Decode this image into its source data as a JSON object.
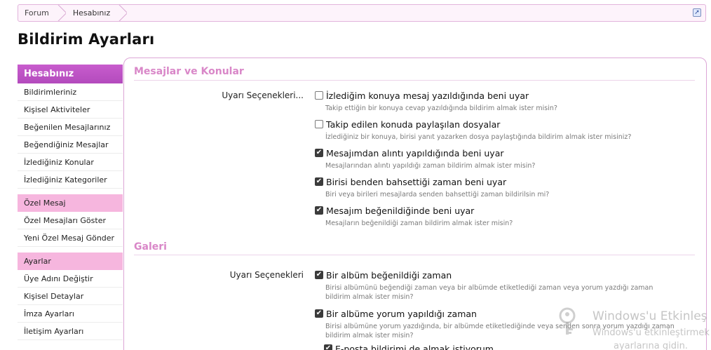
{
  "breadcrumb": {
    "items": [
      "Forum",
      "Hesabınız"
    ],
    "jump_icon": "jump-arrow-icon"
  },
  "page_title": "Bildirim Ayarları",
  "sidebar": {
    "header": "Hesabınız",
    "account_items": [
      "Bildirimleriniz",
      "Kişisel Aktiviteler",
      "Beğenilen Mesajlarınız",
      "Beğendiğiniz Mesajlar",
      "İzlediğiniz Konular",
      "İzlediğiniz Kategoriler"
    ],
    "pm_header": "Özel Mesaj",
    "pm_items": [
      "Özel Mesajları Göster",
      "Yeni Özel Mesaj Gönder"
    ],
    "settings_header": "Ayarlar",
    "settings_items": [
      "Üye Adını Değiştir",
      "Kişisel Detaylar",
      "İmza Ayarları",
      "İletişim Ayarları"
    ]
  },
  "sections": {
    "messages": {
      "title": "Mesajlar ve Konular",
      "row_label": "Uyarı Seçenekleri...",
      "options": [
        {
          "label": "İzlediğim konuya mesaj yazıldığında beni uyar",
          "hint": "Takip ettiğin bir konuya cevap yazıldığında bildirim almak ister misin?",
          "checked": false
        },
        {
          "label": "Takip edilen konuda paylaşılan dosyalar",
          "hint": "İzlediğiniz bir konuya, birisi yanıt yazarken dosya paylaştığında bildirim almak ister misiniz?",
          "checked": false
        },
        {
          "label": "Mesajımdan alıntı yapıldığında beni uyar",
          "hint": "Mesajlarından alıntı yapıldığı zaman bildirim almak ister misin?",
          "checked": true
        },
        {
          "label": "Birisi benden bahsettiği zaman beni uyar",
          "hint": "Biri veya birileri mesajlarda senden bahsettiği zaman bildirilsin mi?",
          "checked": true
        },
        {
          "label": "Mesajım beğenildiğinde beni uyar",
          "hint": "Mesajların beğenildiği zaman bildirim almak ister misin?",
          "checked": true
        }
      ]
    },
    "gallery": {
      "title": "Galeri",
      "row_label": "Uyarı Seçenekleri",
      "options": [
        {
          "label": "Bir albüm beğenildiği zaman",
          "hint": "Birisi albümünü beğendiği zaman veya bir albümde etiketlediği zaman veya yorum yazdığı zaman bildirim almak ister misin?",
          "checked": true
        },
        {
          "label": "Bir albüme yorum yapıldığı zaman",
          "hint": "Birisi albümüne yorum yazdığında, bir albümde etiketlediğinde veya senden sonra yorum yazdığı zaman bildirim almak ister misin?",
          "checked": true
        },
        {
          "label": "E-posta bildirimi de almak istiyorum",
          "hint": "",
          "checked": true
        }
      ]
    }
  },
  "watermark": {
    "line1": "Windows'u Etkinleş",
    "line2": "Windows'u etkinleştirmek",
    "line3": "ayarlarına gidin."
  }
}
